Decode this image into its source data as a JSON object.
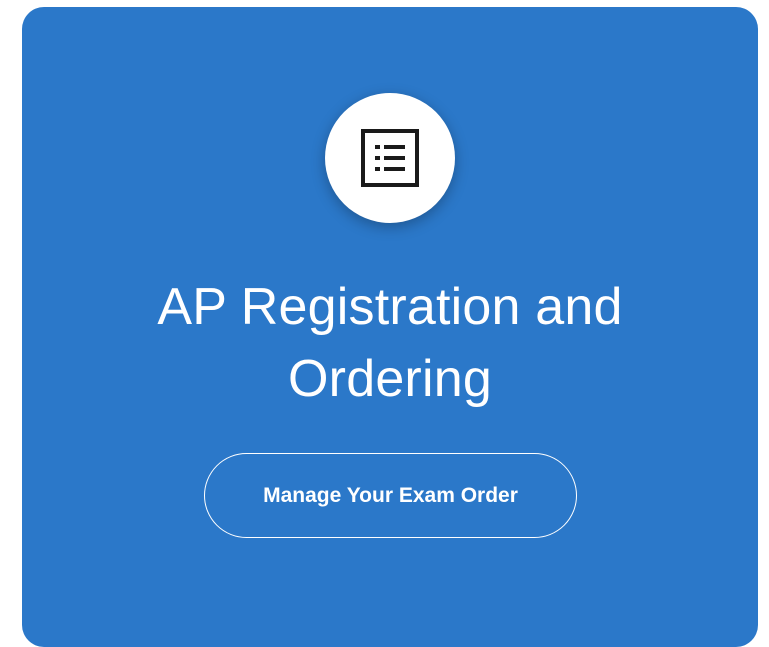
{
  "card": {
    "icon": "list-icon",
    "title_line1": "AP Registration and",
    "title_line2": "Ordering",
    "button_label": "Manage Your Exam Order"
  },
  "colors": {
    "card_background": "#2b78c9",
    "text": "#ffffff",
    "icon_circle": "#ffffff",
    "icon": "#1a1a1a"
  }
}
